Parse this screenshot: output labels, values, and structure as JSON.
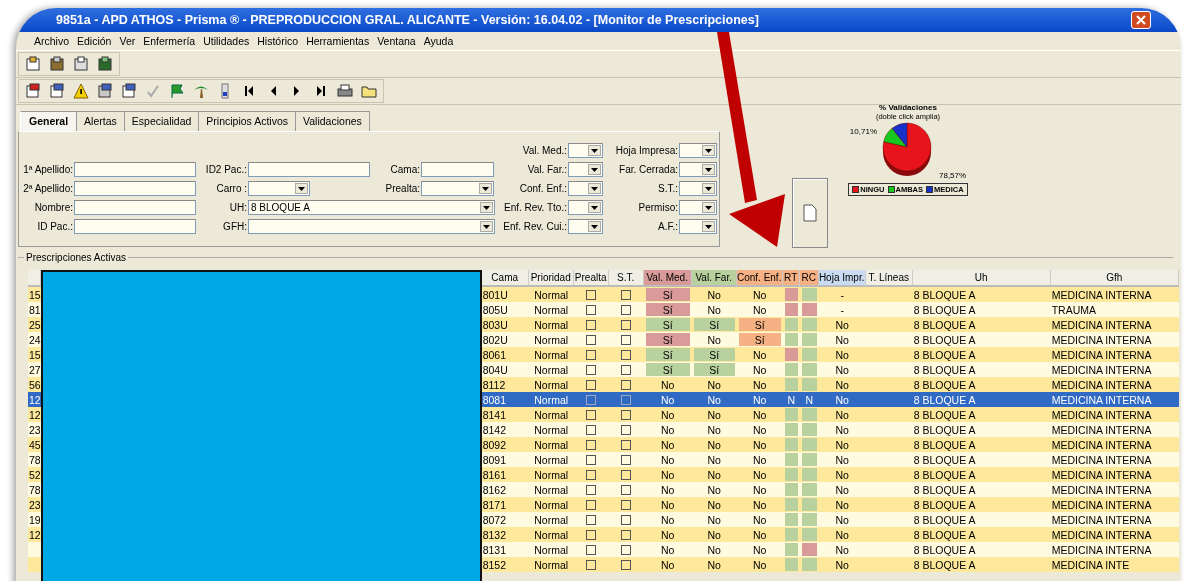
{
  "window": {
    "title": "9851a - APD ATHOS - Prisma ® - PREPRODUCCION GRAL. ALICANTE - Versión: 16.04.02 - [Monitor de Prescripciones]"
  },
  "menu": [
    "Archivo",
    "Edición",
    "Ver",
    "Enfermería",
    "Utilidades",
    "Histórico",
    "Herramientas",
    "Ventana",
    "Ayuda"
  ],
  "tabs": [
    {
      "label": "General",
      "selected": true
    },
    {
      "label": "Alertas",
      "selected": false
    },
    {
      "label": "Especialidad",
      "selected": false
    },
    {
      "label": "Principios Activos",
      "selected": false
    },
    {
      "label": "Validaciones",
      "selected": false
    }
  ],
  "patient_fields": [
    [
      {
        "label": "1ª Apellido:",
        "kind": "text"
      },
      {
        "label": "ID2 Pac.:",
        "kind": "text"
      },
      {
        "label": "Cama:",
        "kind": "text"
      }
    ],
    [
      {
        "label": "2ª Apellido:",
        "kind": "text"
      },
      {
        "label": "Carro :",
        "kind": "select"
      },
      {
        "label": "Prealta:",
        "kind": "select"
      }
    ],
    [
      {
        "label": "Nombre:",
        "kind": "text"
      },
      {
        "label": "UH:",
        "kind": "select",
        "value": "8 BLOQUE A"
      }
    ],
    [
      {
        "label": "ID Pac.:",
        "kind": "text"
      },
      {
        "label": "GFH:",
        "kind": "select"
      }
    ]
  ],
  "filters": [
    [
      {
        "label": "Val. Med.:"
      },
      {
        "label": "Val. Far.:"
      },
      {
        "label": "Conf. Enf.:"
      },
      {
        "label": "Enf. Rev. Tto.:"
      },
      {
        "label": "Enf. Rev. Cui.:"
      }
    ],
    [
      {
        "label": "Hoja Impresa:"
      },
      {
        "label": "Far. Cerrada:"
      },
      {
        "label": "S.T.:"
      },
      {
        "label": "Permiso:"
      },
      {
        "label": "A.F.:"
      }
    ]
  ],
  "chart_panel": {
    "hint": "(doble click amplia)",
    "chart_data": {
      "type": "pie",
      "title": "% Validaciones",
      "categories": [
        "NINGU",
        "AMBAS",
        "MEDICA"
      ],
      "values": [
        78.57,
        10.71,
        10.71
      ],
      "colors": [
        "#e8141b",
        "#18c81e",
        "#1632c8"
      ],
      "value_labels": [
        "78,57%",
        "10,71%",
        null
      ],
      "legend": "bottom"
    }
  },
  "group_title": "Prescripciones Activas",
  "columns": [
    {
      "label": "Cama"
    },
    {
      "label": "Prioridad"
    },
    {
      "label": "Prealta"
    },
    {
      "label": "S.T."
    },
    {
      "label": "Val. Med.",
      "color": "#d99a9a"
    },
    {
      "label": "Val. Far.",
      "color": "#b8d19f"
    },
    {
      "label": "Conf. Enf.",
      "color": "#f5b183"
    },
    {
      "label": "RT",
      "color": "#f5b183"
    },
    {
      "label": "RC",
      "color": "#f5b183"
    },
    {
      "label": "Hoja Impr.",
      "color": "#c9dcf2"
    },
    {
      "label": "T. Líneas"
    },
    {
      "label": "Uh"
    },
    {
      "label": "Gfh"
    }
  ],
  "rows": [
    {
      "id": "15",
      "cama": "801U",
      "prioridad": "Normal",
      "prealta": false,
      "st": false,
      "val_med": {
        "text": "Sí",
        "color": "#d99a9a"
      },
      "val_far": {
        "text": "No"
      },
      "conf_enf": {
        "text": "No"
      },
      "rt": {
        "color": "#d99a9a"
      },
      "rc": {
        "color": "#b8d19f"
      },
      "hoja": "-",
      "uh": "8 BLOQUE A",
      "gfh": "MEDICINA INTERNA",
      "selected": false
    },
    {
      "id": "81",
      "cama": "805U",
      "prioridad": "Normal",
      "prealta": false,
      "st": false,
      "val_med": {
        "text": "Sí",
        "color": "#d99a9a"
      },
      "val_far": {
        "text": "No"
      },
      "conf_enf": {
        "text": "No"
      },
      "rt": {
        "color": "#d99a9a"
      },
      "rc": {
        "color": "#d99a9a"
      },
      "hoja": "-",
      "uh": "8 BLOQUE A",
      "gfh": "TRAUMA",
      "selected": false
    },
    {
      "id": "25",
      "cama": "803U",
      "prioridad": "Normal",
      "prealta": false,
      "st": false,
      "val_med": {
        "text": "Sí",
        "color": "#b8d19f"
      },
      "val_far": {
        "text": "Sí",
        "color": "#b8d19f"
      },
      "conf_enf": {
        "text": "Sí",
        "color": "#f5b183"
      },
      "rt": {
        "color": "#b8d19f"
      },
      "rc": {
        "color": "#b8d19f"
      },
      "hoja": "No",
      "uh": "8 BLOQUE A",
      "gfh": "MEDICINA INTERNA",
      "selected": false
    },
    {
      "id": "24",
      "cama": "802U",
      "prioridad": "Normal",
      "prealta": false,
      "st": false,
      "val_med": {
        "text": "Sí",
        "color": "#d99a9a"
      },
      "val_far": {
        "text": "No"
      },
      "conf_enf": {
        "text": "Sí",
        "color": "#f5b183"
      },
      "rt": {
        "color": "#b8d19f"
      },
      "rc": {
        "color": "#b8d19f"
      },
      "hoja": "No",
      "uh": "8 BLOQUE A",
      "gfh": "MEDICINA INTERNA",
      "selected": false
    },
    {
      "id": "15",
      "cama": "8061",
      "prioridad": "Normal",
      "prealta": false,
      "st": false,
      "val_med": {
        "text": "Sí",
        "color": "#b8d19f"
      },
      "val_far": {
        "text": "Sí",
        "color": "#b8d19f"
      },
      "conf_enf": {
        "text": "No"
      },
      "rt": {
        "color": "#d99a9a"
      },
      "rc": {
        "color": "#b8d19f"
      },
      "hoja": "No",
      "uh": "8 BLOQUE A",
      "gfh": "MEDICINA INTERNA",
      "selected": false
    },
    {
      "id": "27",
      "cama": "804U",
      "prioridad": "Normal",
      "prealta": false,
      "st": false,
      "val_med": {
        "text": "Sí",
        "color": "#b8d19f"
      },
      "val_far": {
        "text": "Sí",
        "color": "#b8d19f"
      },
      "conf_enf": {
        "text": "No"
      },
      "rt": {
        "color": "#b8d19f"
      },
      "rc": {
        "color": "#b8d19f"
      },
      "hoja": "No",
      "uh": "8 BLOQUE A",
      "gfh": "MEDICINA INTERNA",
      "selected": false
    },
    {
      "id": "56",
      "cama": "8112",
      "prioridad": "Normal",
      "prealta": false,
      "st": false,
      "val_med": {
        "text": "No"
      },
      "val_far": {
        "text": "No"
      },
      "conf_enf": {
        "text": "No"
      },
      "rt": {
        "color": "#b8d19f"
      },
      "rc": {
        "color": "#b8d19f"
      },
      "hoja": "No",
      "uh": "8 BLOQUE A",
      "gfh": "MEDICINA INTERNA",
      "selected": false
    },
    {
      "id": "12",
      "cama": "8081",
      "prioridad": "Normal",
      "prealta": false,
      "st": false,
      "val_med": {
        "text": "No"
      },
      "val_far": {
        "text": "No"
      },
      "conf_enf": {
        "text": "No"
      },
      "rt": {
        "text": "N"
      },
      "rc": {
        "text": "N"
      },
      "hoja": "No",
      "uh": "8 BLOQUE A",
      "gfh": "MEDICINA INTERNA",
      "selected": true
    },
    {
      "id": "12",
      "cama": "8141",
      "prioridad": "Normal",
      "prealta": false,
      "st": false,
      "val_med": {
        "text": "No"
      },
      "val_far": {
        "text": "No"
      },
      "conf_enf": {
        "text": "No"
      },
      "rt": {
        "color": "#b8d19f"
      },
      "rc": {
        "color": "#b8d19f"
      },
      "hoja": "No",
      "uh": "8 BLOQUE A",
      "gfh": "MEDICINA INTERNA",
      "selected": false
    },
    {
      "id": "23",
      "cama": "8142",
      "prioridad": "Normal",
      "prealta": false,
      "st": false,
      "val_med": {
        "text": "No"
      },
      "val_far": {
        "text": "No"
      },
      "conf_enf": {
        "text": "No"
      },
      "rt": {
        "color": "#b8d19f"
      },
      "rc": {
        "color": "#b8d19f"
      },
      "hoja": "No",
      "uh": "8 BLOQUE A",
      "gfh": "MEDICINA INTERNA",
      "selected": false
    },
    {
      "id": "45",
      "cama": "8092",
      "prioridad": "Normal",
      "prealta": false,
      "st": false,
      "val_med": {
        "text": "No"
      },
      "val_far": {
        "text": "No"
      },
      "conf_enf": {
        "text": "No"
      },
      "rt": {
        "color": "#b8d19f"
      },
      "rc": {
        "color": "#b8d19f"
      },
      "hoja": "No",
      "uh": "8 BLOQUE A",
      "gfh": "MEDICINA INTERNA",
      "selected": false
    },
    {
      "id": "78",
      "cama": "8091",
      "prioridad": "Normal",
      "prealta": false,
      "st": false,
      "val_med": {
        "text": "No"
      },
      "val_far": {
        "text": "No"
      },
      "conf_enf": {
        "text": "No"
      },
      "rt": {
        "color": "#b8d19f"
      },
      "rc": {
        "color": "#b8d19f"
      },
      "hoja": "No",
      "uh": "8 BLOQUE A",
      "gfh": "MEDICINA INTERNA",
      "selected": false
    },
    {
      "id": "52",
      "cama": "8161",
      "prioridad": "Normal",
      "prealta": false,
      "st": false,
      "val_med": {
        "text": "No"
      },
      "val_far": {
        "text": "No"
      },
      "conf_enf": {
        "text": "No"
      },
      "rt": {
        "color": "#b8d19f"
      },
      "rc": {
        "color": "#b8d19f"
      },
      "hoja": "No",
      "uh": "8 BLOQUE A",
      "gfh": "MEDICINA INTERNA",
      "selected": false
    },
    {
      "id": "78",
      "cama": "8162",
      "prioridad": "Normal",
      "prealta": false,
      "st": false,
      "val_med": {
        "text": "No"
      },
      "val_far": {
        "text": "No"
      },
      "conf_enf": {
        "text": "No"
      },
      "rt": {
        "color": "#b8d19f"
      },
      "rc": {
        "color": "#b8d19f"
      },
      "hoja": "No",
      "uh": "8 BLOQUE A",
      "gfh": "MEDICINA INTERNA",
      "selected": false
    },
    {
      "id": "23",
      "cama": "8171",
      "prioridad": "Normal",
      "prealta": false,
      "st": false,
      "val_med": {
        "text": "No"
      },
      "val_far": {
        "text": "No"
      },
      "conf_enf": {
        "text": "No"
      },
      "rt": {
        "color": "#b8d19f"
      },
      "rc": {
        "color": "#b8d19f"
      },
      "hoja": "No",
      "uh": "8 BLOQUE A",
      "gfh": "MEDICINA INTERNA",
      "selected": false
    },
    {
      "id": "19",
      "cama": "8072",
      "prioridad": "Normal",
      "prealta": false,
      "st": false,
      "val_med": {
        "text": "No"
      },
      "val_far": {
        "text": "No"
      },
      "conf_enf": {
        "text": "No"
      },
      "rt": {
        "color": "#b8d19f"
      },
      "rc": {
        "color": "#b8d19f"
      },
      "hoja": "No",
      "uh": "8 BLOQUE A",
      "gfh": "MEDICINA INTERNA",
      "selected": false
    },
    {
      "id": "12",
      "cama": "8132",
      "prioridad": "Normal",
      "prealta": false,
      "st": false,
      "val_med": {
        "text": "No"
      },
      "val_far": {
        "text": "No"
      },
      "conf_enf": {
        "text": "No"
      },
      "rt": {
        "color": "#b8d19f"
      },
      "rc": {
        "color": "#b8d19f"
      },
      "hoja": "No",
      "uh": "8 BLOQUE A",
      "gfh": "MEDICINA INTERNA",
      "selected": false
    },
    {
      "cama": "8131",
      "prioridad": "Normal",
      "prealta": false,
      "st": false,
      "val_med": {
        "text": "No"
      },
      "val_far": {
        "text": "No"
      },
      "conf_enf": {
        "text": "No"
      },
      "rt": {
        "color": "#b8d19f"
      },
      "rc": {
        "color": "#d99a9a"
      },
      "hoja": "No",
      "uh": "8 BLOQUE A",
      "gfh": "MEDICINA INTERNA",
      "selected": false
    },
    {
      "cama": "8152",
      "prioridad": "Normal",
      "prealta": false,
      "st": false,
      "val_med": {
        "text": "No"
      },
      "val_far": {
        "text": "No"
      },
      "conf_enf": {
        "text": "No"
      },
      "rt": {
        "color": "#b8d19f"
      },
      "rc": {
        "color": "#b8d19f"
      },
      "hoja": "No",
      "uh": "8 BLOQUE A",
      "gfh": "MEDICINA INTE",
      "selected": false
    }
  ]
}
